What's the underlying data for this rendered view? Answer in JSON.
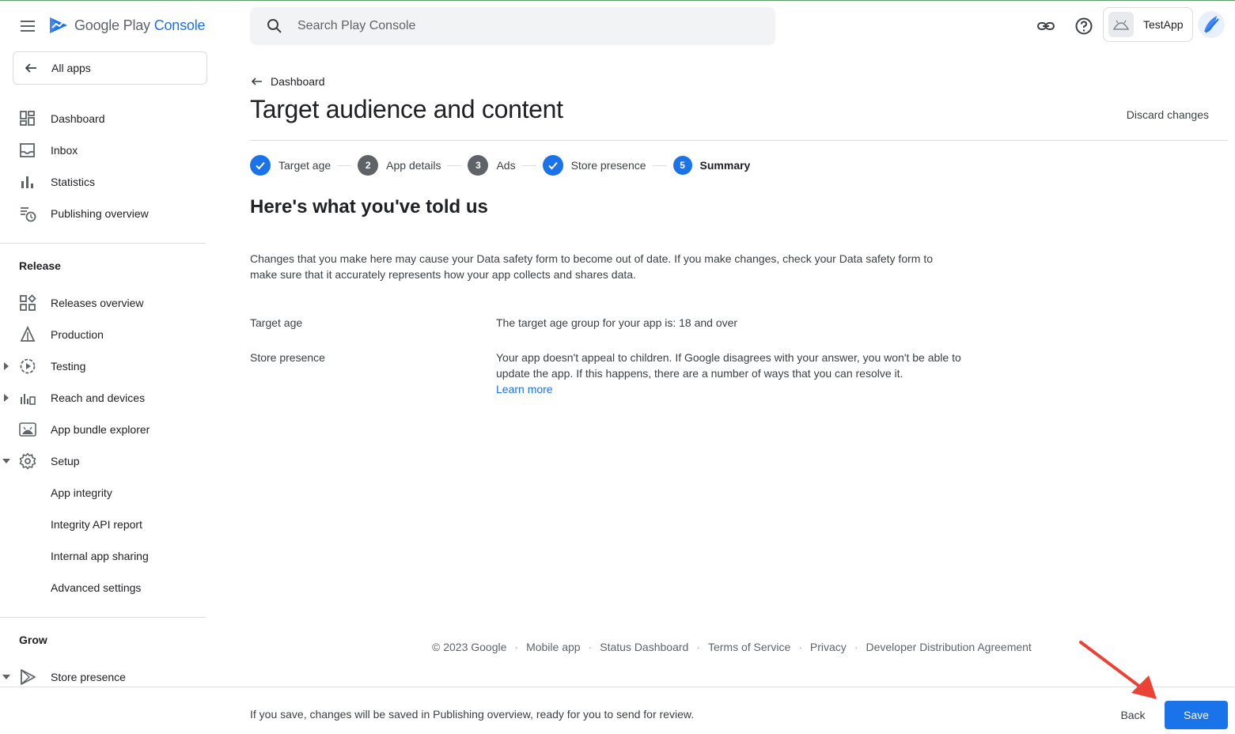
{
  "brand": {
    "name": "Google Play",
    "accent": "Console"
  },
  "sidebar": {
    "all_apps": "All apps",
    "top_items": [
      {
        "label": "Dashboard",
        "icon": "dashboard-icon"
      },
      {
        "label": "Inbox",
        "icon": "inbox-icon"
      },
      {
        "label": "Statistics",
        "icon": "statistics-icon"
      },
      {
        "label": "Publishing overview",
        "icon": "publishing-overview-icon"
      }
    ],
    "release_header": "Release",
    "release_items": [
      {
        "label": "Releases overview",
        "icon": "releases-overview-icon"
      },
      {
        "label": "Production",
        "icon": "production-icon"
      },
      {
        "label": "Testing",
        "icon": "testing-icon"
      },
      {
        "label": "Reach and devices",
        "icon": "reach-devices-icon"
      },
      {
        "label": "App bundle explorer",
        "icon": "android-icon"
      },
      {
        "label": "Setup",
        "icon": "gear-icon"
      }
    ],
    "setup_subitems": [
      "App integrity",
      "Integrity API report",
      "Internal app sharing",
      "Advanced settings"
    ],
    "grow_header": "Grow",
    "grow_items": [
      {
        "label": "Store presence",
        "icon": "store-presence-icon"
      }
    ]
  },
  "search": {
    "placeholder": "Search Play Console"
  },
  "app_chip": {
    "name": "TestApp"
  },
  "breadcrumb": "Dashboard",
  "page_title": "Target audience and content",
  "discard": "Discard changes",
  "steps": [
    {
      "number": "",
      "label": "Target age",
      "state": "done"
    },
    {
      "number": "2",
      "label": "App details",
      "state": "pending"
    },
    {
      "number": "3",
      "label": "Ads",
      "state": "pending"
    },
    {
      "number": "",
      "label": "Store presence",
      "state": "done"
    },
    {
      "number": "5",
      "label": "Summary",
      "state": "current"
    }
  ],
  "summary": {
    "heading": "Here's what you've told us",
    "notice": "Changes that you make here may cause your Data safety form to become out of date. If you make changes, check your Data safety form to make sure that it accurately represents how your app collects and shares data.",
    "rows": [
      {
        "label": "Target age",
        "value": "The target age group for your app is: 18 and over"
      },
      {
        "label": "Store presence",
        "value": "Your app doesn't appeal to children. If Google disagrees with your answer, you won't be able to update the app. If this happens, there are a number of ways that you can resolve it.",
        "link": "Learn more"
      }
    ]
  },
  "footer": {
    "copyright": "© 2023 Google",
    "links": [
      "Mobile app",
      "Status Dashboard",
      "Terms of Service",
      "Privacy",
      "Developer Distribution Agreement"
    ]
  },
  "action_bar": {
    "message": "If you save, changes will be saved in Publishing overview, ready for you to send for review.",
    "back": "Back",
    "save": "Save"
  },
  "colors": {
    "accent": "#1a73e8",
    "annotation": "#ea4335"
  }
}
